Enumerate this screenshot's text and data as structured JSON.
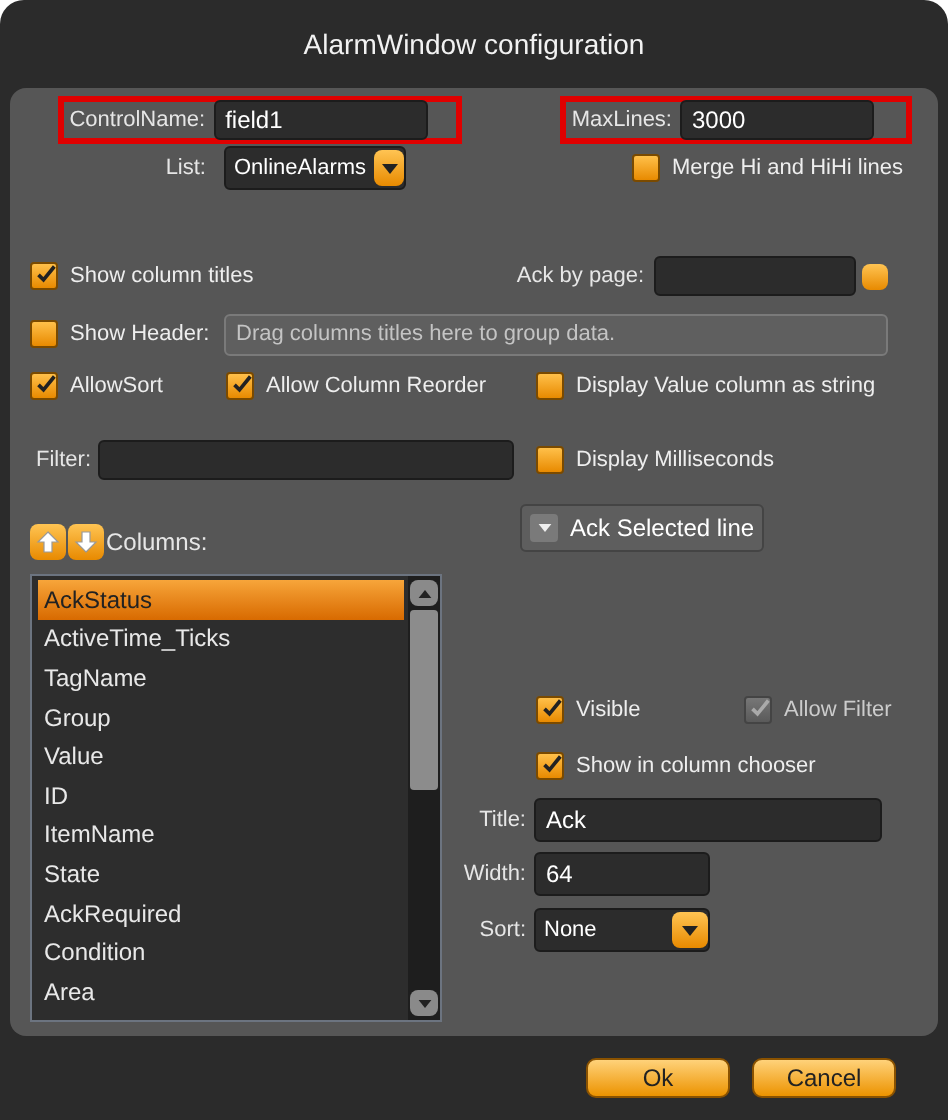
{
  "window": {
    "title": "AlarmWindow configuration"
  },
  "control_name": {
    "label": "ControlName:",
    "value": "field1",
    "highlighted": true
  },
  "max_lines": {
    "label": "MaxLines:",
    "value": "3000",
    "highlighted": true
  },
  "list": {
    "label": "List:",
    "value": "OnlineAlarms"
  },
  "merge_hi_hihi": {
    "label": "Merge Hi and HiHi lines",
    "checked": false
  },
  "show_column_titles": {
    "label": "Show column titles",
    "checked": true
  },
  "ack_by_page": {
    "label": "Ack by page:"
  },
  "show_header": {
    "label": "Show Header:",
    "checked": false
  },
  "group_field": {
    "placeholder": "Drag columns titles here to group data."
  },
  "allow_sort": {
    "label": "AllowSort",
    "checked": true
  },
  "allow_column_reorder": {
    "label": "Allow Column Reorder",
    "checked": true
  },
  "display_value_as_string": {
    "label": "Display Value column as string",
    "checked": false
  },
  "filter": {
    "label": "Filter:"
  },
  "display_milliseconds": {
    "label": "Display Milliseconds",
    "checked": false
  },
  "ack_selected_button": {
    "label": "Ack Selected line"
  },
  "columns": {
    "label": "Columns:",
    "items": [
      {
        "name": "AckStatus",
        "selected": true
      },
      {
        "name": "ActiveTime_Ticks",
        "selected": false
      },
      {
        "name": "TagName",
        "selected": false
      },
      {
        "name": "Group",
        "selected": false
      },
      {
        "name": "Value",
        "selected": false
      },
      {
        "name": "ID",
        "selected": false
      },
      {
        "name": "ItemName",
        "selected": false
      },
      {
        "name": "State",
        "selected": false
      },
      {
        "name": "AckRequired",
        "selected": false
      },
      {
        "name": "Condition",
        "selected": false
      },
      {
        "name": "Area",
        "selected": false
      }
    ]
  },
  "column_settings": {
    "visible": {
      "label": "Visible",
      "checked": true,
      "disabled": false
    },
    "allow_filter": {
      "label": "Allow Filter",
      "checked": true,
      "disabled": true
    },
    "show_in_column_chooser": {
      "label": "Show in column chooser",
      "checked": true,
      "disabled": false
    },
    "title": {
      "label": "Title:",
      "value": "Ack"
    },
    "width": {
      "label": "Width:",
      "value": "64"
    },
    "sort": {
      "label": "Sort:",
      "value": "None"
    }
  },
  "buttons": [
    {
      "label": "Ok"
    },
    {
      "label": "Cancel"
    }
  ]
}
